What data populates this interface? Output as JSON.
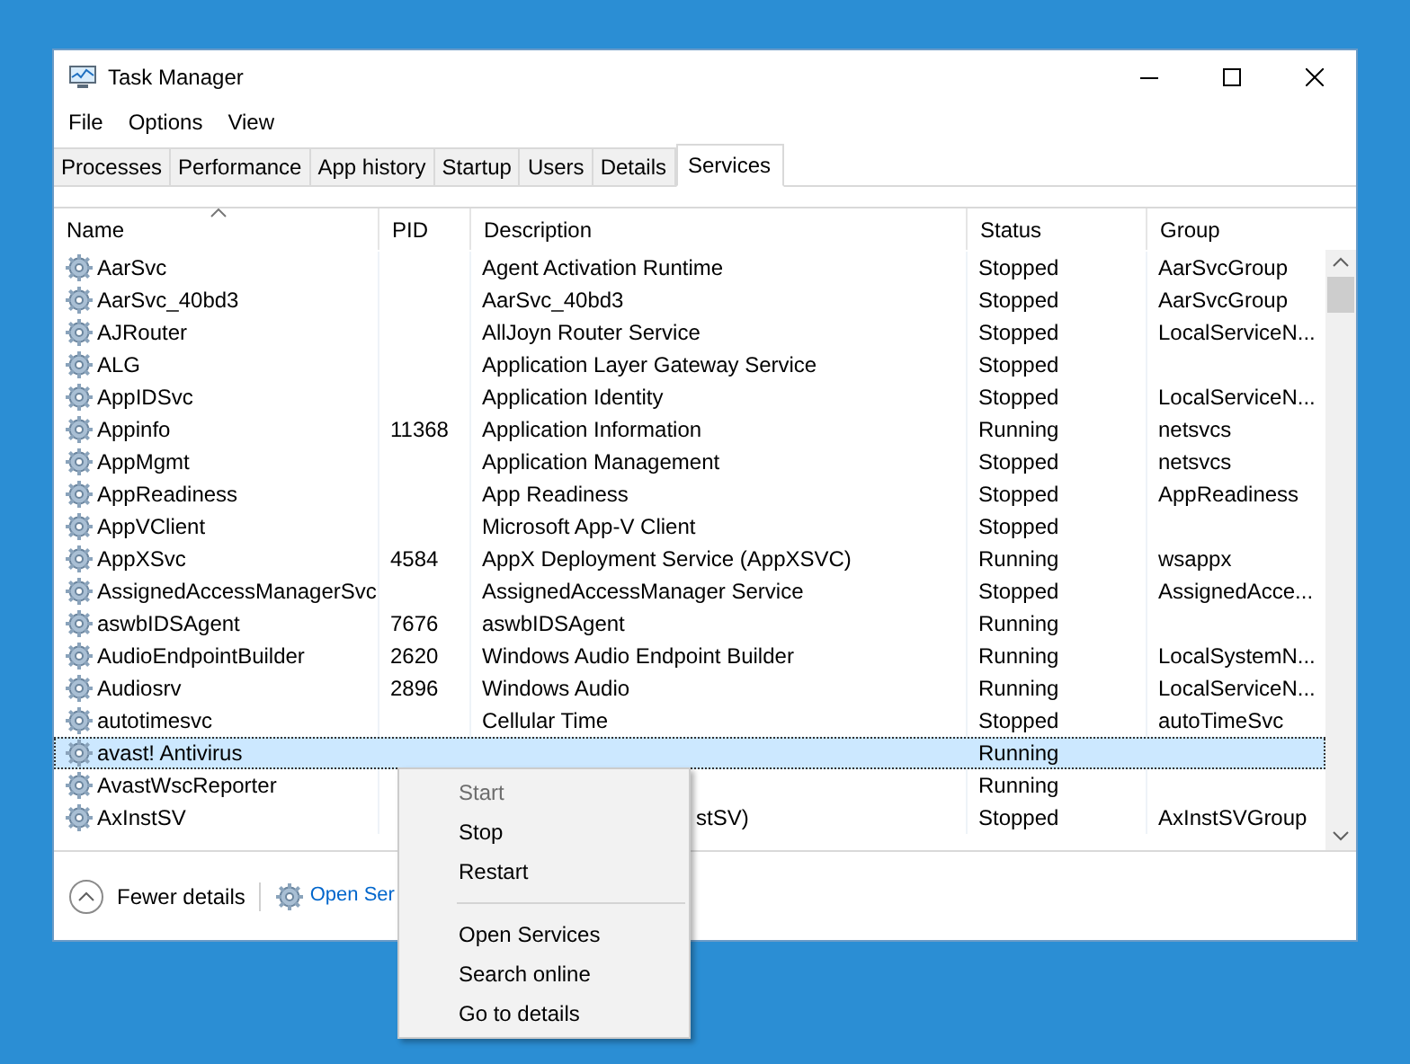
{
  "window": {
    "title": "Task Manager"
  },
  "menu_bar": [
    "File",
    "Options",
    "View"
  ],
  "tabs": [
    {
      "label": "Processes",
      "selected": false
    },
    {
      "label": "Performance",
      "selected": false
    },
    {
      "label": "App history",
      "selected": false
    },
    {
      "label": "Startup",
      "selected": false
    },
    {
      "label": "Users",
      "selected": false
    },
    {
      "label": "Details",
      "selected": false
    },
    {
      "label": "Services",
      "selected": true
    }
  ],
  "table": {
    "columns": [
      "Name",
      "PID",
      "Description",
      "Status",
      "Group"
    ],
    "rows": [
      {
        "name": "AarSvc",
        "pid": "",
        "description": "Agent Activation Runtime",
        "status": "Stopped",
        "group": "AarSvcGroup",
        "selected": false
      },
      {
        "name": "AarSvc_40bd3",
        "pid": "",
        "description": "AarSvc_40bd3",
        "status": "Stopped",
        "group": "AarSvcGroup",
        "selected": false
      },
      {
        "name": "AJRouter",
        "pid": "",
        "description": "AllJoyn Router Service",
        "status": "Stopped",
        "group": "LocalServiceN...",
        "selected": false
      },
      {
        "name": "ALG",
        "pid": "",
        "description": "Application Layer Gateway Service",
        "status": "Stopped",
        "group": "",
        "selected": false
      },
      {
        "name": "AppIDSvc",
        "pid": "",
        "description": "Application Identity",
        "status": "Stopped",
        "group": "LocalServiceN...",
        "selected": false
      },
      {
        "name": "Appinfo",
        "pid": "11368",
        "description": "Application Information",
        "status": "Running",
        "group": "netsvcs",
        "selected": false
      },
      {
        "name": "AppMgmt",
        "pid": "",
        "description": "Application Management",
        "status": "Stopped",
        "group": "netsvcs",
        "selected": false
      },
      {
        "name": "AppReadiness",
        "pid": "",
        "description": "App Readiness",
        "status": "Stopped",
        "group": "AppReadiness",
        "selected": false
      },
      {
        "name": "AppVClient",
        "pid": "",
        "description": "Microsoft App-V Client",
        "status": "Stopped",
        "group": "",
        "selected": false
      },
      {
        "name": "AppXSvc",
        "pid": "4584",
        "description": "AppX Deployment Service (AppXSVC)",
        "status": "Running",
        "group": "wsappx",
        "selected": false
      },
      {
        "name": "AssignedAccessManagerSvc",
        "pid": "",
        "description": "AssignedAccessManager Service",
        "status": "Stopped",
        "group": "AssignedAcce...",
        "selected": false
      },
      {
        "name": "aswbIDSAgent",
        "pid": "7676",
        "description": "aswbIDSAgent",
        "status": "Running",
        "group": "",
        "selected": false
      },
      {
        "name": "AudioEndpointBuilder",
        "pid": "2620",
        "description": "Windows Audio Endpoint Builder",
        "status": "Running",
        "group": "LocalSystemN...",
        "selected": false
      },
      {
        "name": "Audiosrv",
        "pid": "2896",
        "description": "Windows Audio",
        "status": "Running",
        "group": "LocalServiceN...",
        "selected": false
      },
      {
        "name": "autotimesvc",
        "pid": "",
        "description": "Cellular Time",
        "status": "Stopped",
        "group": "autoTimeSvc",
        "selected": false
      },
      {
        "name": "avast! Antivirus",
        "pid": "",
        "description": "",
        "status": "Running",
        "group": "",
        "selected": true
      },
      {
        "name": "AvastWscReporter",
        "pid": "",
        "description": "",
        "status": "Running",
        "group": "",
        "selected": false
      },
      {
        "name": "AxInstSV",
        "pid": "",
        "description": "stSV)",
        "status": "Stopped",
        "group": "AxInstSVGroup",
        "selected": false
      }
    ]
  },
  "footer": {
    "fewer_details": "Fewer details",
    "open_services": "Open Ser"
  },
  "context_menu": [
    {
      "label": "Start",
      "disabled": true
    },
    {
      "label": "Stop",
      "disabled": false
    },
    {
      "label": "Restart",
      "disabled": false
    },
    {
      "kind": "separator"
    },
    {
      "label": "Open Services",
      "disabled": false
    },
    {
      "label": "Search online",
      "disabled": false
    },
    {
      "label": "Go to details",
      "disabled": false
    }
  ]
}
